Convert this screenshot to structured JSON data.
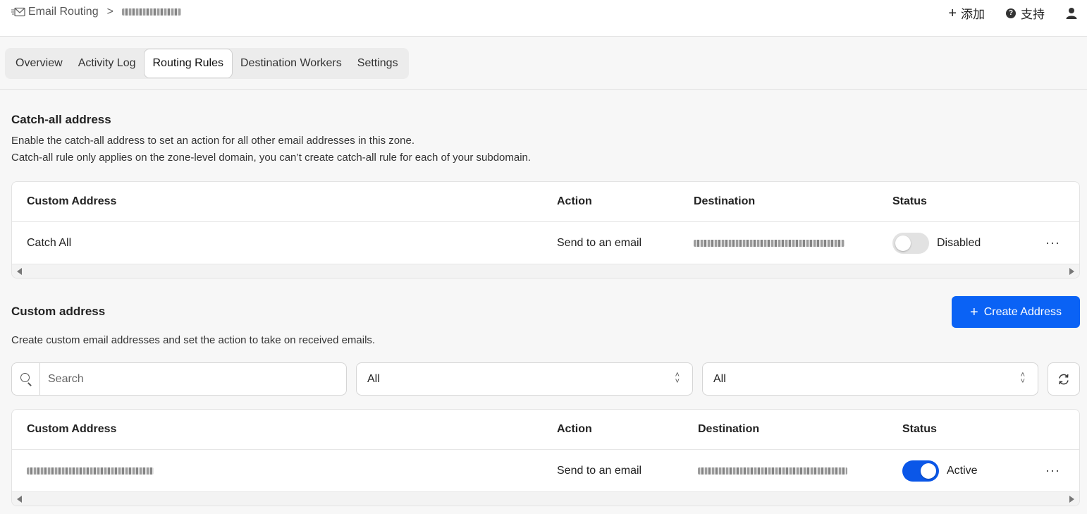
{
  "breadcrumb": {
    "section": "Email Routing",
    "separator": ">"
  },
  "top_actions": {
    "add_label": "添加",
    "support_label": "支持"
  },
  "tabs": [
    {
      "label": "Overview"
    },
    {
      "label": "Activity Log"
    },
    {
      "label": "Routing Rules",
      "active": true
    },
    {
      "label": "Destination Workers"
    },
    {
      "label": "Settings"
    }
  ],
  "catch_all": {
    "title": "Catch-all address",
    "desc1": "Enable the catch-all address to set an action for all other email addresses in this zone.",
    "desc2": "Catch-all rule only applies on the zone-level domain, you can’t create catch-all rule for each of your subdomain.",
    "columns": [
      "Custom Address",
      "Action",
      "Destination",
      "Status"
    ],
    "row": {
      "address": "Catch All",
      "action": "Send to an email",
      "status": "Disabled",
      "enabled": false
    }
  },
  "custom": {
    "title": "Custom address",
    "desc": "Create custom email addresses and set the action to take on received emails.",
    "create_label": "Create Address",
    "search_placeholder": "Search",
    "filter1": "All",
    "filter2": "All",
    "columns": [
      "Custom Address",
      "Action",
      "Destination",
      "Status"
    ],
    "row": {
      "action": "Send to an email",
      "status": "Active",
      "enabled": true
    }
  },
  "colors": {
    "primary": "#0a62f5",
    "toggle_on": "#0b57e8",
    "toggle_off": "#e2e2e2"
  }
}
